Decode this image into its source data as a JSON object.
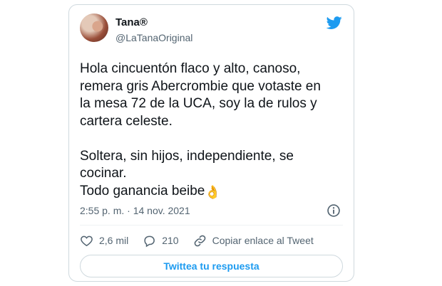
{
  "tweet": {
    "author": {
      "display_name": "Tana®",
      "handle": "@LaTanaOriginal"
    },
    "text_lines": [
      "Hola cincuentón flaco y alto, canoso,",
      "remera gris Abercrombie que votaste en",
      "la mesa 72 de la UCA, soy la de rulos y",
      "cartera celeste.",
      "",
      "Soltera, sin hijos, independiente, se",
      "cocinar.",
      "Todo ganancia beibe"
    ],
    "emoji": "👌",
    "timestamp": "2:55 p. m. · 14 nov. 2021",
    "actions": {
      "likes": "2,6 mil",
      "replies": "210",
      "copy_link": "Copiar enlace al Tweet"
    },
    "reply_button_label": "Twittea tu respuesta"
  },
  "icons": {
    "brand": "twitter-bird-icon",
    "info": "info-icon",
    "like": "heart-icon",
    "reply": "reply-bubble-icon",
    "link": "link-icon"
  },
  "colors": {
    "brand": "#1d9bf0",
    "text": "#0f1419",
    "secondary": "#536471",
    "border": "#cfd9de"
  }
}
